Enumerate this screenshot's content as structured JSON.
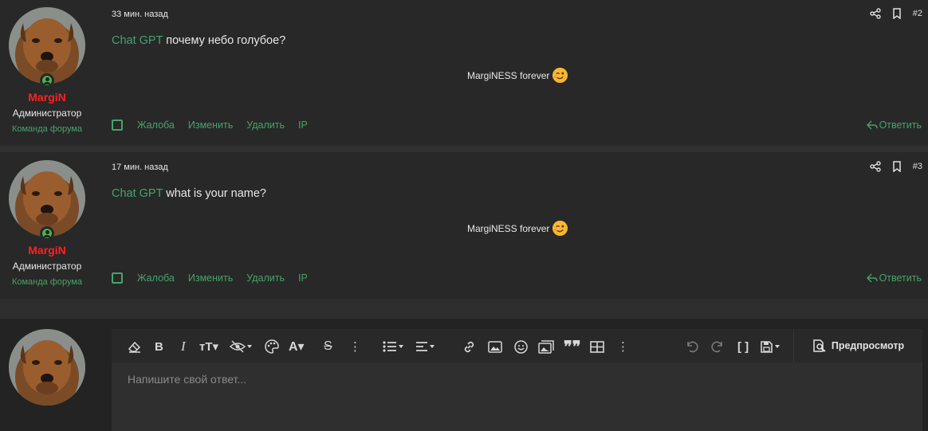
{
  "posts": [
    {
      "author": "MargiN",
      "role": "Администратор",
      "team": "Команда форума",
      "time": "33 мин. назад",
      "mention": "Chat GPT",
      "text": "почему небо голубое?",
      "signature": "MargiNESS forever",
      "number": "#2",
      "actions": [
        "Жалоба",
        "Изменить",
        "Удалить",
        "IP"
      ],
      "reply": "Ответить"
    },
    {
      "author": "MargiN",
      "role": "Администратор",
      "team": "Команда форума",
      "time": "17 мин. назад",
      "mention": "Chat GPT",
      "text": "what is your name?",
      "signature": "MargiNESS forever",
      "number": "#3",
      "actions": [
        "Жалоба",
        "Изменить",
        "Удалить",
        "IP"
      ],
      "reply": "Ответить"
    }
  ],
  "editor": {
    "placeholder": "Напишите свой ответ...",
    "preview_label": "Предпросмотр",
    "toolbar_icons": [
      "eraser-icon",
      "bold-icon",
      "italic-icon",
      "text-size-icon",
      "hide-icon",
      "color-icon",
      "font-icon",
      "strike-icon",
      "more-icon",
      "list-icon",
      "align-icon",
      "link-icon",
      "image-icon",
      "smilie-icon",
      "media-icon",
      "quote-icon",
      "table-icon",
      "more-icon",
      "undo-icon",
      "redo-icon",
      "bbcode-icon",
      "drafts-icon"
    ]
  },
  "colors": {
    "accent": "#47a36a",
    "username": "#ff2020",
    "background": "#282828"
  }
}
